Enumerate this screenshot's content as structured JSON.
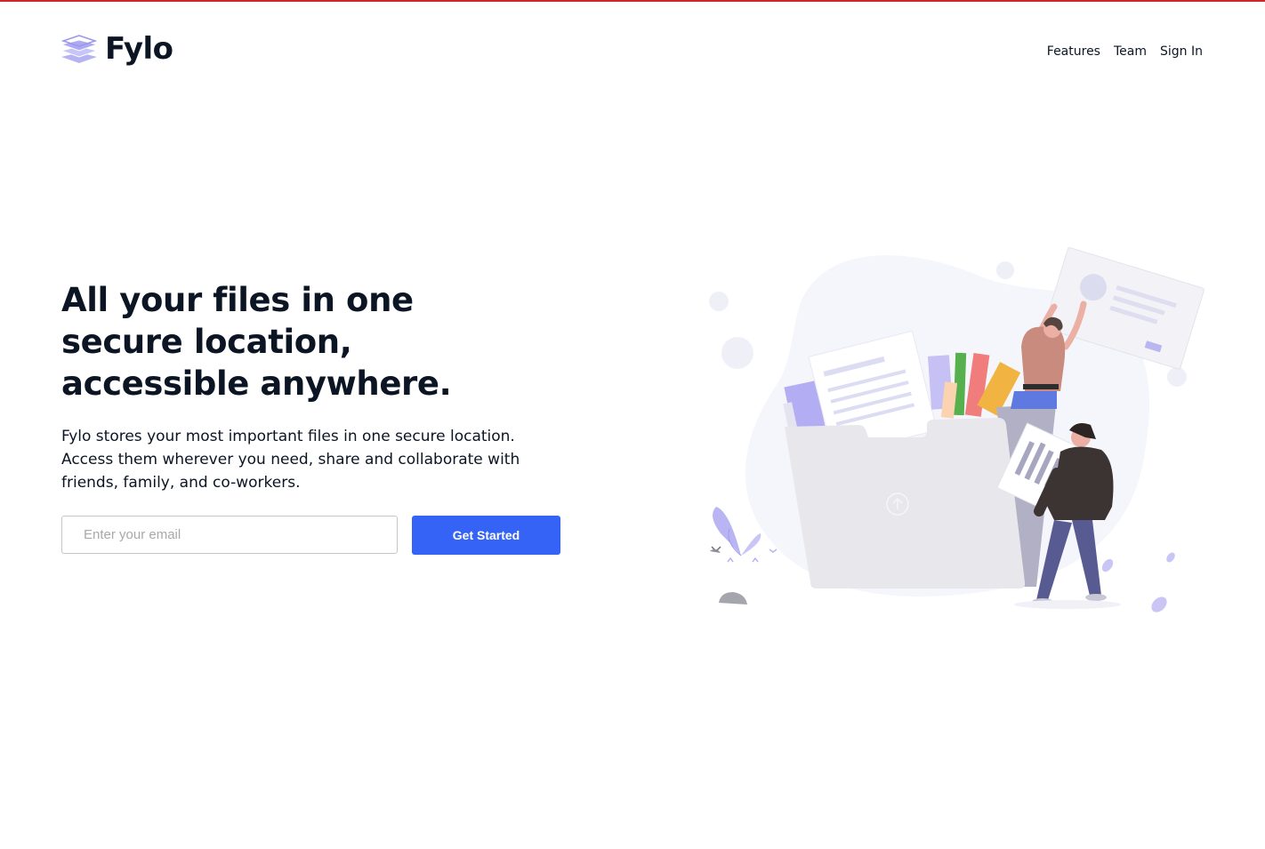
{
  "brand": {
    "name": "Fylo",
    "accent_color": "#3563f5",
    "top_bar_color": "#c8282e",
    "logo_icon": "stacked-layers-icon"
  },
  "nav": {
    "items": [
      {
        "label": "Features"
      },
      {
        "label": "Team"
      },
      {
        "label": "Sign In"
      }
    ]
  },
  "hero": {
    "title": "All your files in one secure location, accessible anywhere.",
    "description": "Fylo stores your most important files in one secure location. Access them wherever you need, share and collaborate with friends, family, and co-workers.",
    "email_placeholder": "Enter your email",
    "email_value": "",
    "cta_label": "Get Started",
    "illustration_icon": "file-sharing-illustration"
  }
}
